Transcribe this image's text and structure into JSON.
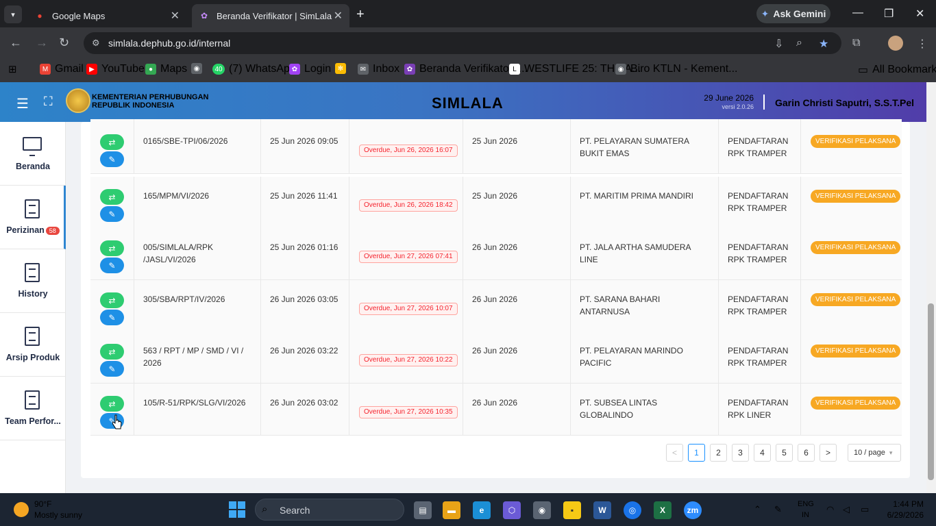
{
  "browser": {
    "tabs": [
      {
        "title": "Google Maps",
        "favicon": "maps-pin-icon"
      },
      {
        "title": "Beranda Verifikator | SimLala",
        "favicon": "simlala-favicon"
      }
    ],
    "ask_gemini": "Ask Gemini",
    "url": "simlala.dephub.go.id/internal",
    "bookmarks": [
      {
        "label": "Gmail",
        "icon": "gmail-icon",
        "color": "#ea4335"
      },
      {
        "label": "YouTube",
        "icon": "youtube-icon",
        "color": "#ff0000"
      },
      {
        "label": "Maps",
        "icon": "maps-icon",
        "color": "#34a853"
      },
      {
        "label": "",
        "icon": "globe-icon",
        "color": "#9aa0a6"
      },
      {
        "label": "(7) WhatsApp",
        "icon": "whatsapp-icon",
        "color": "#25d366",
        "badge": "40"
      },
      {
        "label": "Login",
        "icon": "login-icon",
        "color": "#a142f4"
      },
      {
        "label": "",
        "icon": "pinwheel-icon",
        "color": "#fbbc04"
      },
      {
        "label": "Inbox",
        "icon": "mail-icon",
        "color": "#9aa0a6"
      },
      {
        "label": "Beranda Verifikator |...",
        "icon": "simlala-favicon",
        "color": "#a142f4"
      },
      {
        "label": "WESTLIFE 25: THE A...",
        "icon": "letterboxd-icon",
        "color": "#ffffff"
      },
      {
        "label": "Biro KTLN - Kement...",
        "icon": "globe-icon",
        "color": "#9aa0a6"
      }
    ],
    "all_bookmarks": "All Bookmarks"
  },
  "header": {
    "org_line1": "KEMENTERIAN PERHUBUNGAN",
    "org_line2": "REPUBLIK INDONESIA",
    "title": "SIMLALA",
    "date": "29 June 2026",
    "version": "versi 2.0.26",
    "user": "Garin Christi Saputri, S.S.T.Pel"
  },
  "sidebar": {
    "items": [
      {
        "label": "Beranda"
      },
      {
        "label": "Perizinan",
        "badge": "58"
      },
      {
        "label": "History"
      },
      {
        "label": "Arsip Produk"
      },
      {
        "label": "Team Perfor..."
      }
    ]
  },
  "table": {
    "rows": [
      {
        "no": "0165/SBE-TPI/06/2026",
        "submitted": "25 Jun 2026 09:05",
        "deadline": "Overdue, Jun 26, 2026 16:07",
        "date": "25 Jun 2026",
        "company": "PT. PELAYARAN SUMATERA BUKIT EMAS",
        "type": "PENDAFTARAN RPK TRAMPER",
        "status": "VERIFIKASI PELAKSANA"
      },
      {
        "no": "165/MPM/VI/2026",
        "submitted": "25 Jun 2026 11:41",
        "deadline": "Overdue, Jun 26, 2026 18:42",
        "date": "25 Jun 2026",
        "company": "PT. MARITIM PRIMA MANDIRI",
        "type": "PENDAFTARAN RPK TRAMPER",
        "status": "VERIFIKASI PELAKSANA"
      },
      {
        "no": "005/SIMLALA/RPK /JASL/VI/2026",
        "submitted": "25 Jun 2026 01:16",
        "deadline": "Overdue, Jun 27, 2026 07:41",
        "date": "26 Jun 2026",
        "company": "PT. JALA ARTHA SAMUDERA LINE",
        "type": "PENDAFTARAN RPK TRAMPER",
        "status": "VERIFIKASI PELAKSANA"
      },
      {
        "no": "305/SBA/RPT/IV/2026",
        "submitted": "26 Jun 2026 03:05",
        "deadline": "Overdue, Jun 27, 2026 10:07",
        "date": "26 Jun 2026",
        "company": "PT. SARANA BAHARI ANTARNUSA",
        "type": "PENDAFTARAN RPK TRAMPER",
        "status": "VERIFIKASI PELAKSANA"
      },
      {
        "no": "563 / RPT / MP / SMD / VI / 2026",
        "submitted": "26 Jun 2026 03:22",
        "deadline": "Overdue, Jun 27, 2026 10:22",
        "date": "26 Jun 2026",
        "company": "PT. PELAYARAN MARINDO PACIFIC",
        "type": "PENDAFTARAN RPK TRAMPER",
        "status": "VERIFIKASI PELAKSANA"
      },
      {
        "no": "105/R-51/RPK/SLG/VI/2026",
        "submitted": "26 Jun 2026 03:02",
        "deadline": "Overdue, Jun 27, 2026 10:35",
        "date": "26 Jun 2026",
        "company": "PT. SUBSEA LINTAS GLOBALINDO",
        "type": "PENDAFTARAN RPK LINER",
        "status": "VERIFIKASI PELAKSANA"
      }
    ]
  },
  "pagination": {
    "prev": "<",
    "pages": [
      "1",
      "2",
      "3",
      "4",
      "5",
      "6"
    ],
    "current": "1",
    "next": ">",
    "page_size": "10 / page"
  },
  "taskbar": {
    "temp": "90°F",
    "weather": "Mostly sunny",
    "search": "Search",
    "lang1": "ENG",
    "lang2": "IN",
    "time": "1:44 PM",
    "date": "6/29/2026"
  },
  "colors": {
    "accent_green": "#2ecc71",
    "accent_blue": "#1e90e6",
    "status_orange": "#f7a823",
    "overdue_red": "#f5222d"
  }
}
